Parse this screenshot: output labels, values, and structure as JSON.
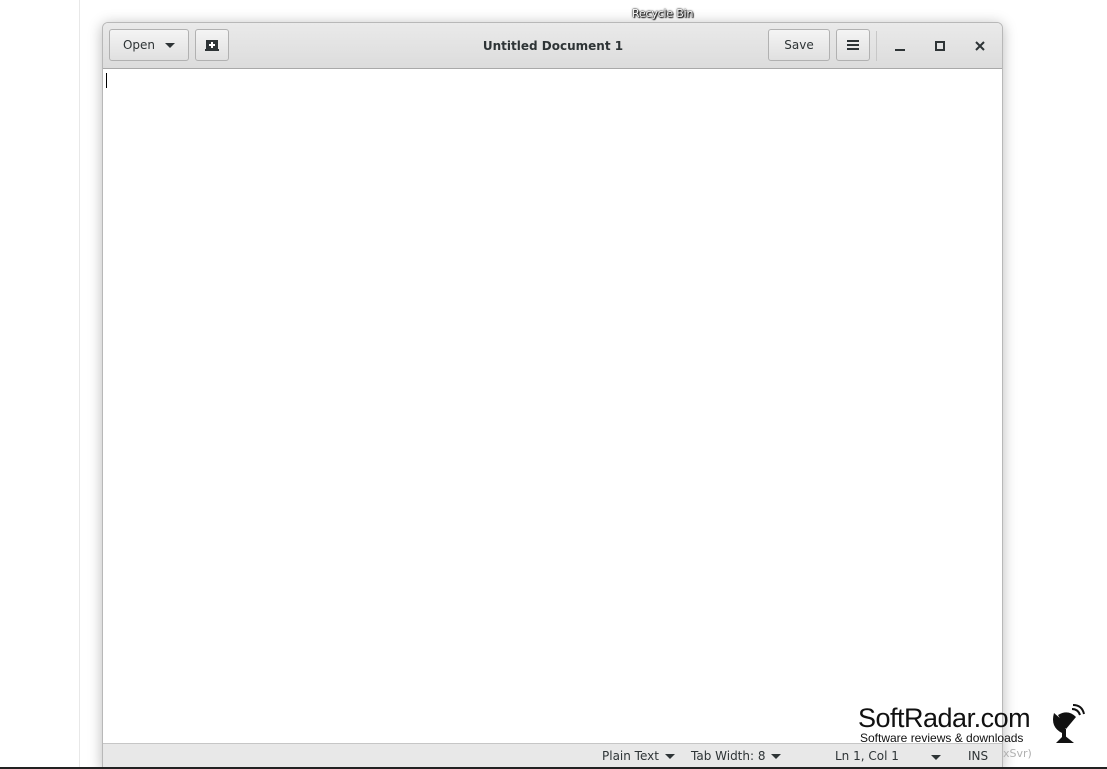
{
  "desktop": {
    "icon_label": "Recycle Bin",
    "taskbar_fragment": "xSvr)"
  },
  "window": {
    "title": "Untitled Document 1",
    "open_label": "Open",
    "save_label": "Save",
    "icons": [
      "new-document-icon",
      "hamburger-menu-icon",
      "minimize-icon",
      "maximize-icon",
      "close-icon"
    ]
  },
  "editor": {
    "content": ""
  },
  "statusbar": {
    "language": "Plain Text",
    "tab_width": "Tab Width: 8",
    "position": "Ln 1, Col 1",
    "mode": "INS"
  },
  "watermark": {
    "brand": "SoftRadar.com",
    "tagline": "Software reviews & downloads"
  }
}
